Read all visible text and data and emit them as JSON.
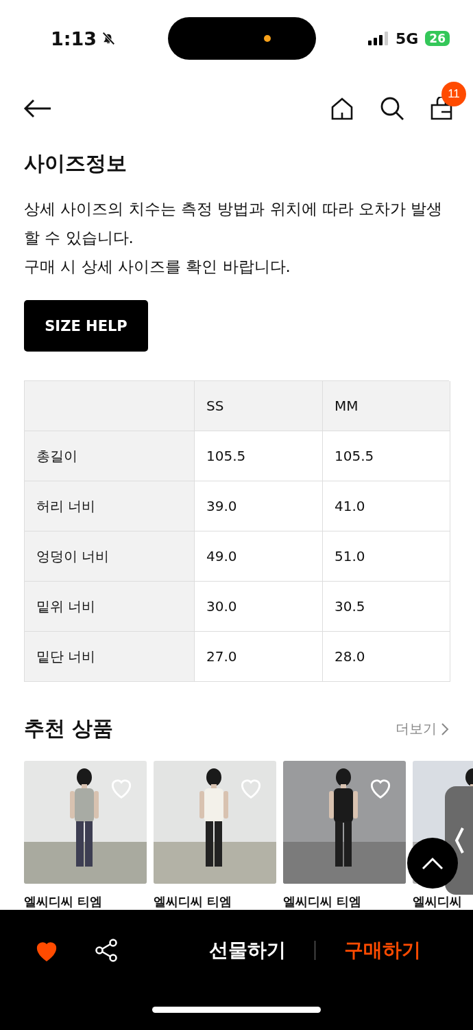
{
  "status_bar": {
    "time": "1:13",
    "network": "5G",
    "battery": "26"
  },
  "nav": {
    "cart_count": "11"
  },
  "size_info": {
    "title": "사이즈정보",
    "description": [
      "상세 사이즈의 치수는 측정 방법과 위치에 따라 오차가 발생할 수 있습니다.",
      "구매 시 상세 사이즈를 확인 바랍니다."
    ],
    "help_button": "SIZE HELP"
  },
  "size_table": {
    "columns": [
      "SS",
      "MM"
    ],
    "rows": [
      {
        "label": "총길이",
        "values": [
          "105.5",
          "105.5"
        ]
      },
      {
        "label": "허리 너비",
        "values": [
          "39.0",
          "41.0"
        ]
      },
      {
        "label": "엉덩이 너비",
        "values": [
          "49.0",
          "51.0"
        ]
      },
      {
        "label": "밑위 너비",
        "values": [
          "30.0",
          "30.5"
        ]
      },
      {
        "label": "밑단 너비",
        "values": [
          "27.0",
          "28.0"
        ]
      }
    ]
  },
  "recommended": {
    "title": "추천 상품",
    "more": "더보기",
    "products": [
      {
        "name": "엘씨디씨 티엠",
        "liked": false
      },
      {
        "name": "엘씨디씨 티엠",
        "liked": false
      },
      {
        "name": "엘씨디씨 티엠",
        "liked": false
      },
      {
        "name": "엘씨디씨"
      }
    ]
  },
  "bottom_bar": {
    "liked": true,
    "gift": "선물하기",
    "buy": "구매하기"
  }
}
